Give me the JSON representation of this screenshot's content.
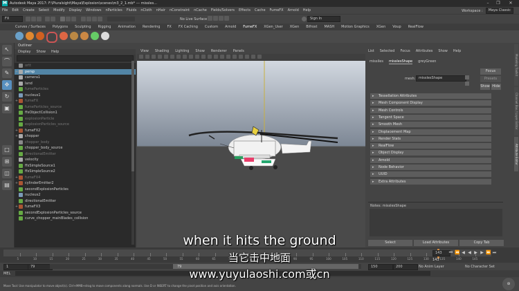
{
  "window": {
    "title": "Autodesk Maya 2017: F:\\Pluralsight\\Maya\\Explosion\\scenes\\m3_2_1.mb*  ---  missles...",
    "controls": [
      "–",
      "❐",
      "✕"
    ]
  },
  "menubar": {
    "items": [
      "File",
      "Edit",
      "Create",
      "Select",
      "Modify",
      "Display",
      "Windows",
      "nParticles",
      "Fluids",
      "nCloth",
      "nHair",
      "nConstraint",
      "nCache",
      "Fields/Solvers",
      "Effects",
      "Cache",
      "FumeFX",
      "Arnold",
      "Help"
    ],
    "workspace_label": "Workspace :",
    "workspace_value": "Maya Classic"
  },
  "statusline": {
    "mode": "FX",
    "live_surface": "No Live Surface",
    "signin": "Sign In"
  },
  "shelf": {
    "tabs": [
      "Curves / Surfaces",
      "Polygons",
      "Sculpting",
      "Rigging",
      "Animation",
      "Rendering",
      "FX",
      "FX Caching",
      "Custom",
      "Arnold",
      "FumeFX",
      "XGen_User",
      "XGen",
      "Bifrost",
      "MASH",
      "Motion Graphics",
      "XGen",
      "Voup",
      "RealFlow"
    ],
    "active_tab": "FumeFX"
  },
  "outliner": {
    "title": "Outliner",
    "menu": [
      "Display",
      "Show",
      "Help"
    ],
    "items": [
      {
        "label": "ortt",
        "state": "dim",
        "color": "#8a8a8a",
        "exp": ""
      },
      {
        "label": "persp",
        "state": "sel",
        "color": "#aaaaaa",
        "exp": "+"
      },
      {
        "label": "camera1",
        "state": "",
        "color": "#aaaaaa",
        "exp": ""
      },
      {
        "label": "land",
        "state": "",
        "color": "#aaaaaa",
        "exp": ""
      },
      {
        "label": "fumeParticles",
        "state": "dim",
        "color": "#66aa44",
        "exp": ""
      },
      {
        "label": "nucleus1",
        "state": "",
        "color": "#7a9ab8",
        "exp": ""
      },
      {
        "label": "fumeFX",
        "state": "dim",
        "color": "#aa5533",
        "exp": "+"
      },
      {
        "label": "fumeParticles_source",
        "state": "dim",
        "color": "#66aa44",
        "exp": ""
      },
      {
        "label": "ffxObjectCollision1",
        "state": "",
        "color": "#66aa44",
        "exp": ""
      },
      {
        "label": "explosionParticle",
        "state": "dim",
        "color": "#66aa44",
        "exp": ""
      },
      {
        "label": "explosionParticles_source",
        "state": "dim",
        "color": "#66aa44",
        "exp": ""
      },
      {
        "label": "fumeFX2",
        "state": "",
        "color": "#aa5533",
        "exp": "+"
      },
      {
        "label": "chopper",
        "state": "",
        "color": "#aaaaaa",
        "exp": "+"
      },
      {
        "label": "chopper_body",
        "state": "dim",
        "color": "#8a8a8a",
        "exp": ""
      },
      {
        "label": "chopper_body_source",
        "state": "",
        "color": "#66aa44",
        "exp": ""
      },
      {
        "label": "directionalEmitter",
        "state": "dim",
        "color": "#66aa44",
        "exp": ""
      },
      {
        "label": "velocity",
        "state": "",
        "color": "#aaaaaa",
        "exp": ""
      },
      {
        "label": "ffxSimpleSource1",
        "state": "",
        "color": "#66aa44",
        "exp": ""
      },
      {
        "label": "ffxSimpleSource2",
        "state": "",
        "color": "#66aa44",
        "exp": ""
      },
      {
        "label": "fumeFX4",
        "state": "dim",
        "color": "#aa5533",
        "exp": "+"
      },
      {
        "label": "cylinderEmitter2",
        "state": "",
        "color": "#aa5533",
        "exp": "+"
      },
      {
        "label": "secondExplosionParticles",
        "state": "",
        "color": "#66aa44",
        "exp": ""
      },
      {
        "label": "nucleus2",
        "state": "",
        "color": "#7a9ab8",
        "exp": ""
      },
      {
        "label": "directionalEmitter",
        "state": "",
        "color": "#66aa44",
        "exp": ""
      },
      {
        "label": "fumeFX3",
        "state": "",
        "color": "#aa5533",
        "exp": "+"
      },
      {
        "label": "secondExplosionParticles_source",
        "state": "",
        "color": "#66aa44",
        "exp": ""
      },
      {
        "label": "curve_chopper_mainBlades_collision",
        "state": "",
        "color": "#66aa44",
        "exp": ""
      }
    ]
  },
  "viewport": {
    "menu": [
      "View",
      "Shading",
      "Lighting",
      "Show",
      "Renderer",
      "Panels"
    ]
  },
  "attribute_editor": {
    "menu": [
      "List",
      "Selected",
      "Focus",
      "Attributes",
      "Show",
      "Help"
    ],
    "tabs": [
      "missiles",
      "misslesShape",
      "greyGreen"
    ],
    "active_tab": "misslesShape",
    "mesh_label": "mesh:",
    "mesh_value": "misslesShape",
    "focus_label": "Focus",
    "presets_label": "Presets",
    "show_label": "Show",
    "hide_label": "Hide",
    "sections": [
      "Tessellation Attributes",
      "Mesh Component Display",
      "Mesh Controls",
      "Tangent Space",
      "Smooth Mesh",
      "Displacement Map",
      "Render Stats",
      "RealFlow",
      "Object Display",
      "Arnold",
      "Node Behavior",
      "UUID",
      "Extra Attributes"
    ],
    "notes_label": "Notes: misslesShape",
    "select_button": "Select",
    "load_button": "Load Attributes",
    "copy_button": "Copy Tab"
  },
  "side_tabs": [
    "Modeling Toolkit",
    "Channel Box / Layer Editor",
    "Attribute Editor"
  ],
  "timeline": {
    "ticks": [
      "5",
      "10",
      "15",
      "20",
      "25",
      "30",
      "35",
      "40",
      "45",
      "50",
      "55",
      "60",
      "65",
      "70",
      "75",
      "80",
      "85",
      "90",
      "95",
      "100",
      "105",
      "110",
      "115",
      "120",
      "125",
      "130",
      "135",
      "140",
      "145"
    ],
    "current_frame": "143"
  },
  "range": {
    "start": "1",
    "playback_start": "79",
    "slider_start": "79",
    "slider_end": "150",
    "playback_end": "150",
    "end": "200",
    "anim_layer": "No Anim Layer",
    "character_set": "No Character Set"
  },
  "cmdline": {
    "label": "MEL"
  },
  "help_line": "Move Tool: Use manipulator to move object(s). Ctrl+MMB+drag to move components along normals. Use D or INSERT to change the pivot position and axis orientation.",
  "subtitles": {
    "english": "when it hits the ground",
    "chinese": "当它击中地面",
    "watermark": "www.yuyulaoshi.com或cn"
  },
  "colors": {
    "sky_top": "#d2d8e0",
    "sky_bottom": "#7c8694",
    "ground": "#4a4a4a",
    "accent": "#5285a6"
  }
}
